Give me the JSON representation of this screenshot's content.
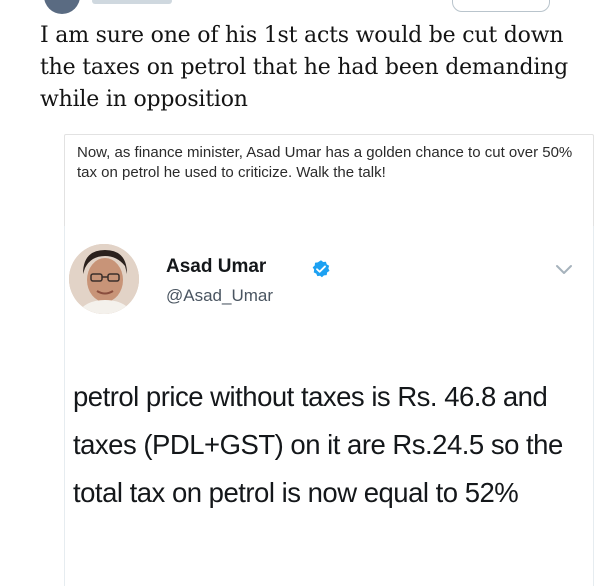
{
  "tweet": {
    "text": "I am sure one of his 1st acts would be cut down the taxes on petrol that he had been demanding while in opposition"
  },
  "quoted": {
    "text": "Now, as finance minister, Asad Umar has a golden chance to cut over 50% tax on petrol he used to criticize. Walk the talk!"
  },
  "embedded": {
    "author_name": "Asad Umar",
    "author_handle": "@Asad_Umar",
    "text": "petrol price without taxes is Rs. 46.8 and taxes (PDL+GST) on it are Rs.24.5 so the total tax on petrol is now equal to 52%"
  },
  "icons": {
    "verified": "verified-badge-icon",
    "menu": "chevron-down-icon"
  },
  "colors": {
    "verified_blue": "#1da1f2",
    "border": "#e2e2e2"
  }
}
